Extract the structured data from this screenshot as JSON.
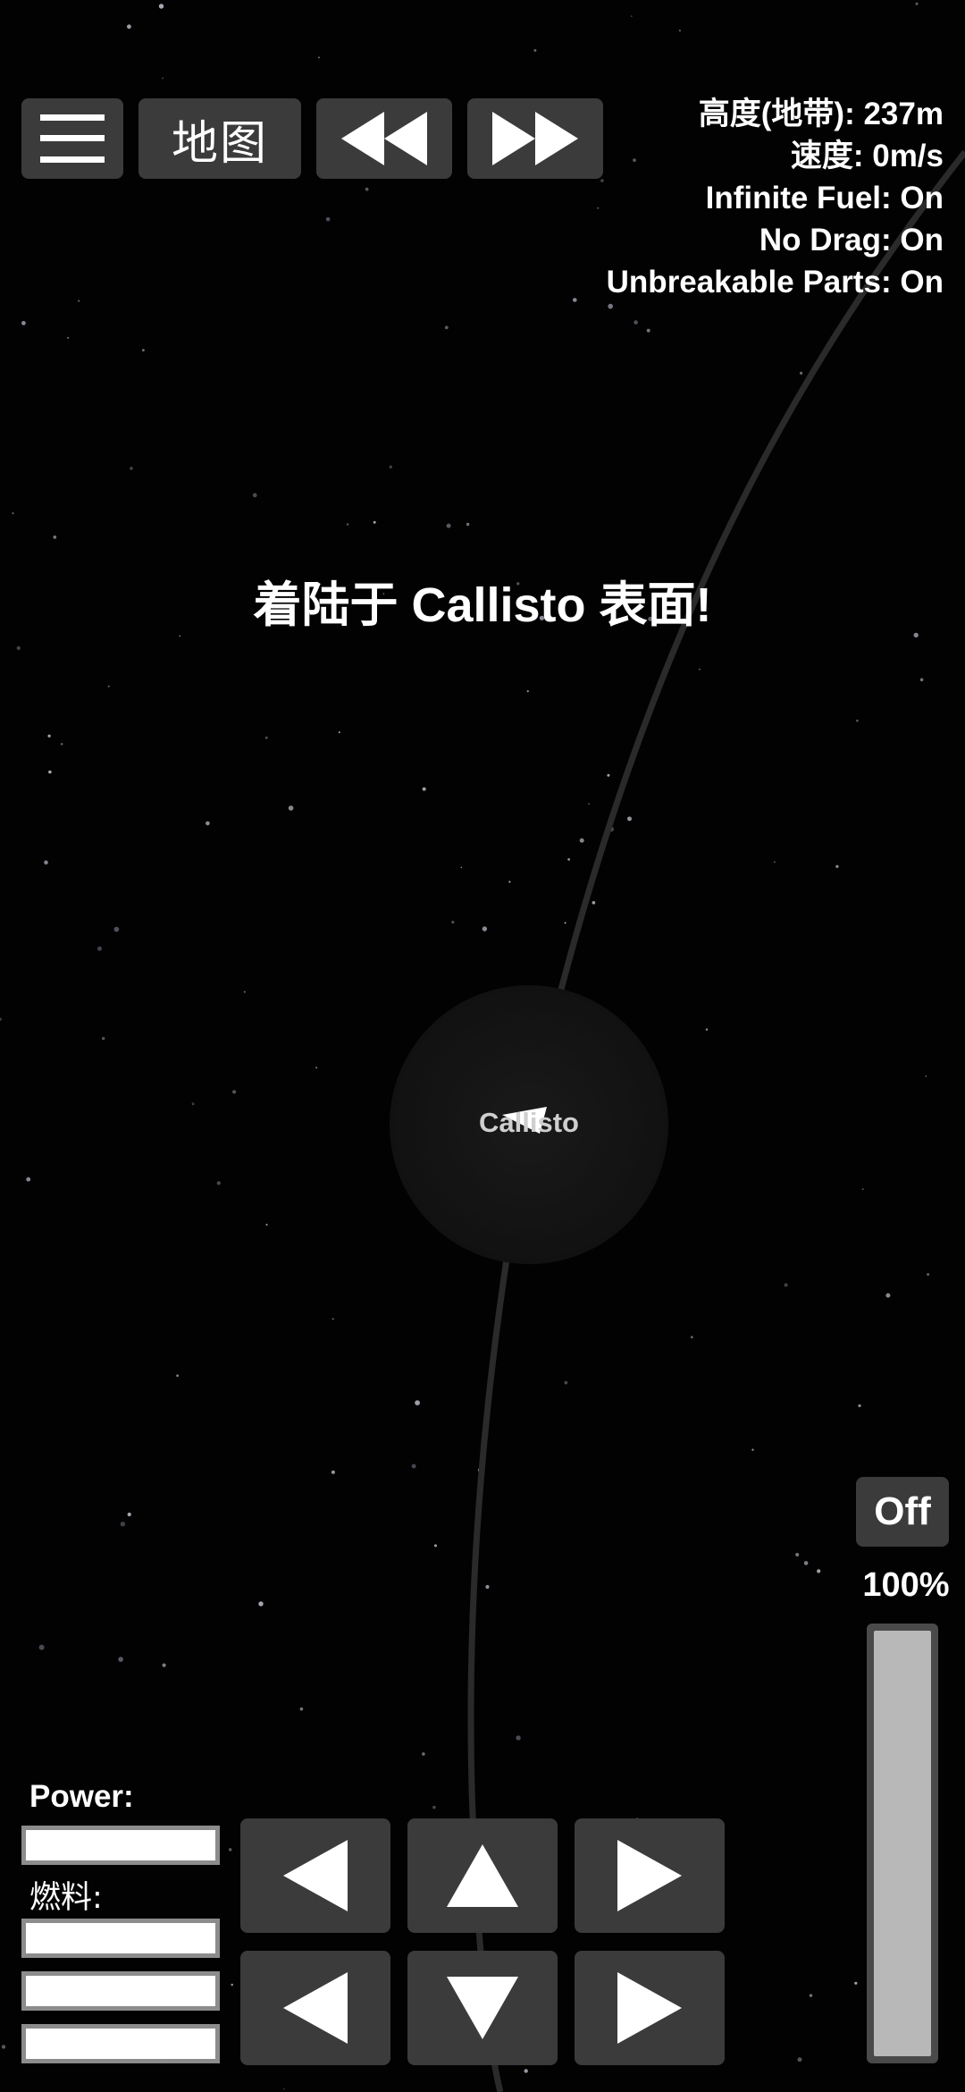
{
  "toolbar": {
    "menu_icon": "hamburger-menu-icon",
    "map_label": "地图",
    "rewind_icon": "double-left-triangle-icon",
    "fastforward_icon": "double-right-triangle-icon"
  },
  "hud": {
    "altitude": "高度(地带): 237m",
    "speed": "速度: 0m/s",
    "infinite_fuel": "Infinite Fuel: On",
    "no_drag": "No Drag: On",
    "unbreakable_parts": "Unbreakable Parts: On"
  },
  "message": {
    "landing": "着陆于 Callisto 表面!"
  },
  "map": {
    "planet_name": "Callisto",
    "ship_icon": "ship-arrow-icon"
  },
  "engine": {
    "toggle_label": "Off",
    "throttle_label": "100%",
    "throttle_fraction": 1.0
  },
  "resources": {
    "power_label": "Power:",
    "fuel_label": "燃料:",
    "bars": [
      {
        "name": "power",
        "fraction": 1.0
      },
      {
        "name": "fuel",
        "fraction": 1.0
      },
      {
        "name": "fuel-2",
        "fraction": 1.0
      },
      {
        "name": "fuel-3",
        "fraction": 1.0
      }
    ]
  },
  "controls": {
    "rotate_left_icon": "left-triangle-icon",
    "up_icon": "up-triangle-icon",
    "rotate_right_icon": "right-triangle-icon",
    "left_icon": "left-triangle-icon",
    "down_icon": "down-triangle-icon",
    "right_icon": "right-triangle-icon"
  },
  "colors": {
    "background": "#020202",
    "button": "#3b3b3b",
    "text": "#ffffff",
    "trajectory": "#2a2a2a"
  }
}
